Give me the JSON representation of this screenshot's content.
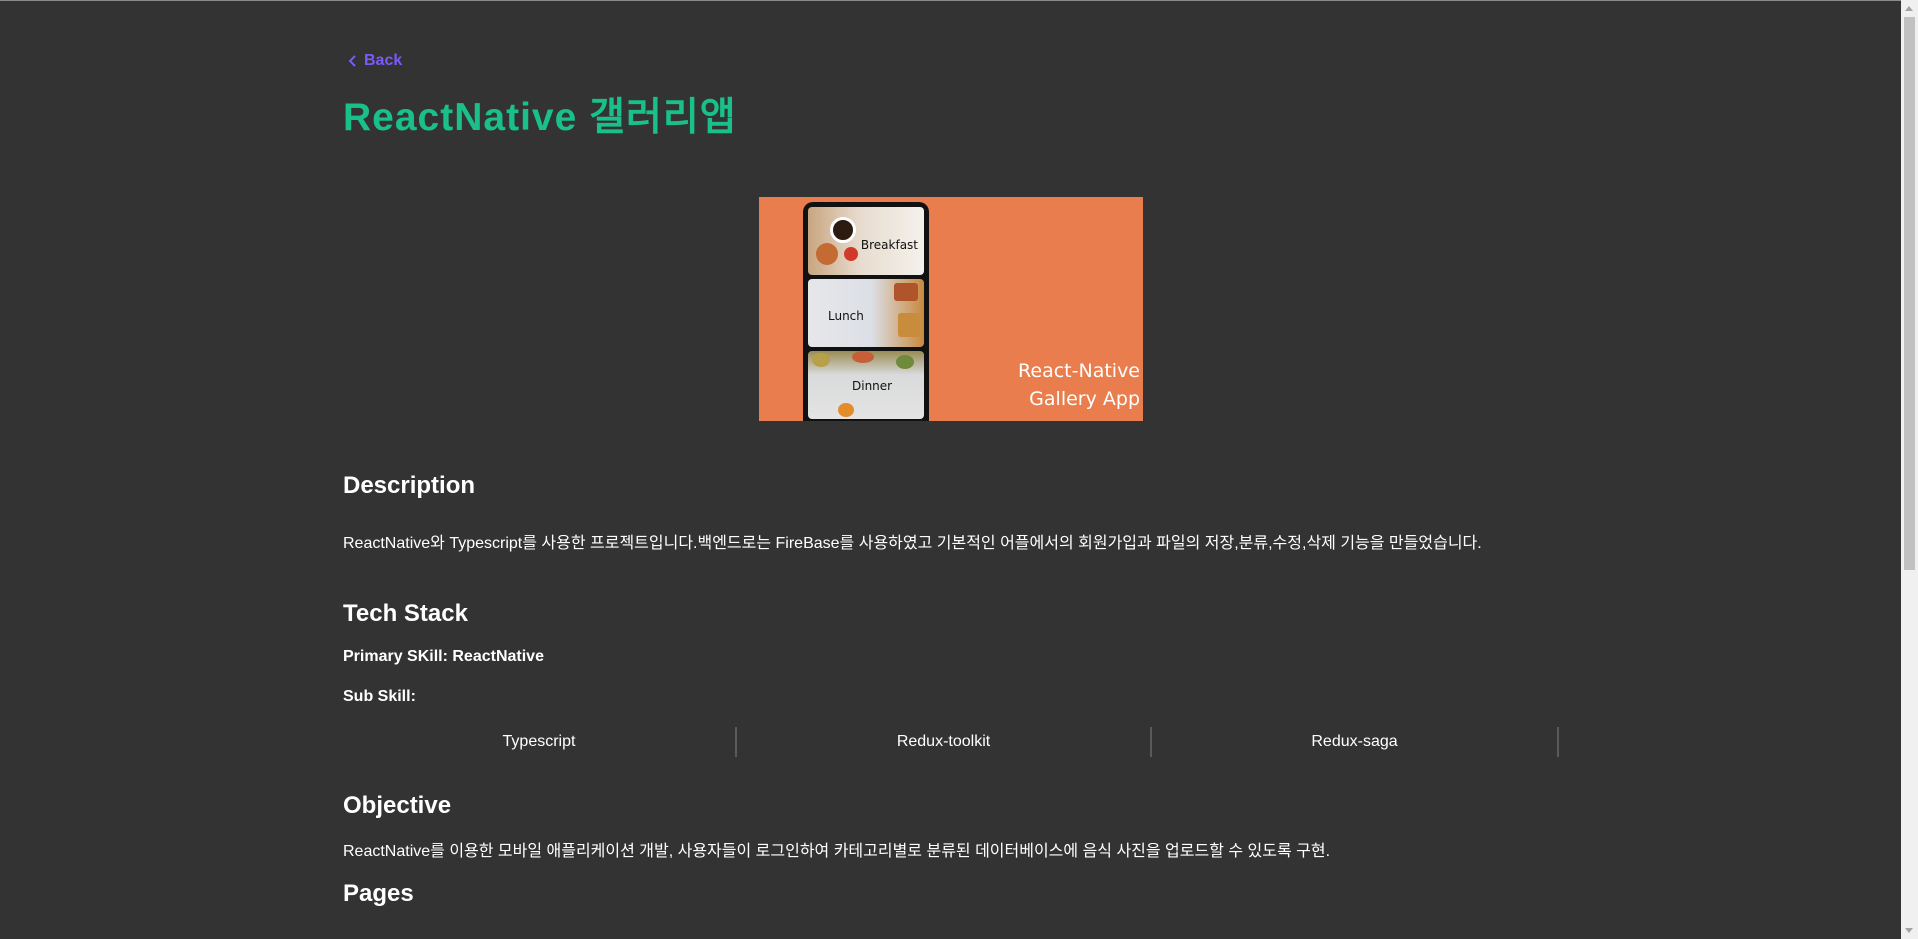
{
  "nav": {
    "back_label": "Back"
  },
  "project": {
    "title": "ReactNative 갤러리앱",
    "hero": {
      "panels": [
        "Breakfast",
        "Lunch",
        "Dinner"
      ],
      "caption_line1": "React-Native",
      "caption_line2": "Gallery App",
      "background_color": "#ea7d4d"
    }
  },
  "sections": {
    "description": {
      "heading": "Description",
      "text": "ReactNative와 Typescript를 사용한 프로젝트입니다.백엔드로는 FireBase를 사용하였고 기본적인 어플에서의 회원가입과 파일의 저장,분류,수정,삭제 기능을 만들었습니다."
    },
    "tech_stack": {
      "heading": "Tech Stack",
      "primary": "Primary SKill: ReactNative",
      "sub_label": "Sub Skill:",
      "sub_skills": [
        "Typescript",
        "Redux-toolkit",
        "Redux-saga"
      ]
    },
    "objective": {
      "heading": "Objective",
      "text": "ReactNative를 이용한 모바일 애플리케이션 개발, 사용자들이 로그인하여 카테고리별로 분류된 데이터베이스에 음식 사진을 업로드할 수 있도록 구현."
    },
    "pages": {
      "heading": "Pages"
    }
  },
  "colors": {
    "background": "#333333",
    "title": "#19c08a",
    "link": "#7a5af8"
  }
}
